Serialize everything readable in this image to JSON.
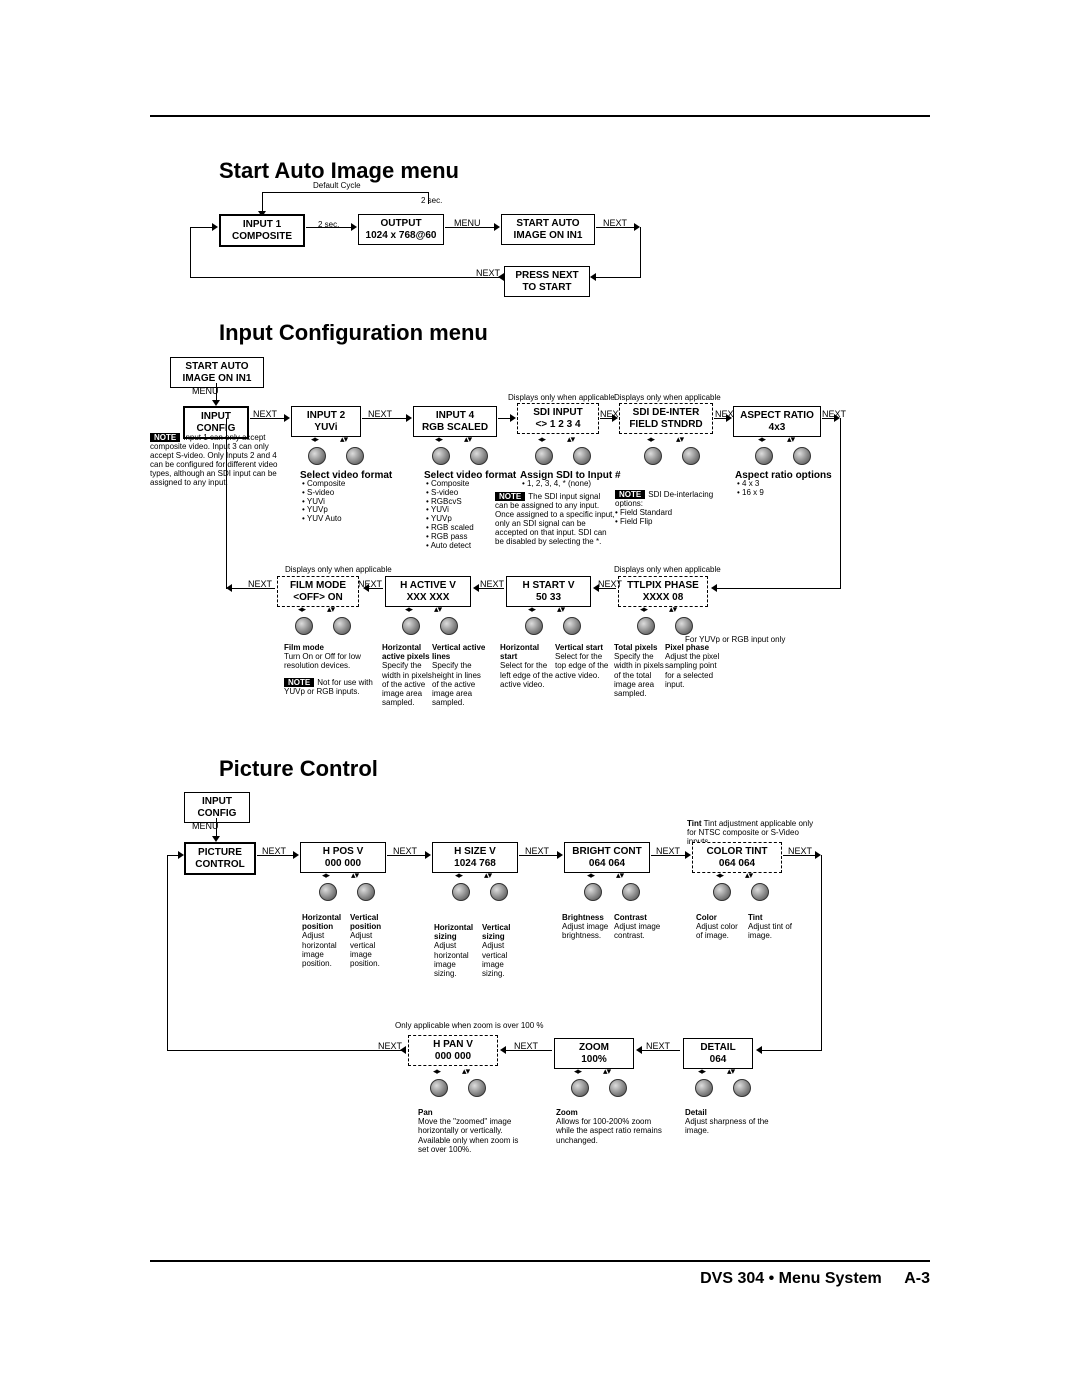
{
  "footer": {
    "product": "DVS 304 • Menu System",
    "page": "A-3"
  },
  "headings": {
    "h1": "Start Auto Image menu",
    "h2": "Input Configuration menu",
    "h3": "Picture Control"
  },
  "flow_labels": {
    "default_cycle": "Default Cycle",
    "two_sec_a": "2 sec.",
    "two_sec_b": "2 sec.",
    "menu": "MENU",
    "next": "NEXT"
  },
  "auto_image": {
    "input1": "INPUT 1\nCOMPOSITE",
    "output": "OUTPUT\n1024 x 768@60",
    "start_auto": "START AUTO\nIMAGE ON IN1",
    "press_next": "PRESS NEXT\nTO START"
  },
  "input_config": {
    "start_auto": "START AUTO\nIMAGE ON IN1",
    "input_config": "INPUT\nCONFIG",
    "input2": "INPUT 2\nYUVi",
    "input4": "INPUT 4\nRGB SCALED",
    "sdi_input": "SDI INPUT\n<>    1 2 3 4",
    "sdi_deinter": "SDI DE-INTER\nFIELD STNDRD",
    "aspect": "ASPECT RATIO\n4x3",
    "film_mode": "FILM MODE\n<OFF> ON",
    "h_active": "H   ACTIVE   V\nXXX     XXX",
    "h_start": "H   START   V\n50         33",
    "ttlpix": "TTLPIX PHASE\nXXXX      08",
    "note_input1": "Input 1 can only accept composite video. Input 3 can only accept S-video. Only Inputs 2 and 4 can be configured for different video types, although an SDI input can be assigned to any input.",
    "applicable1": "Displays only when applicable",
    "applicable2": "Displays only when applicable",
    "applicable3": "Displays only when applicable",
    "applicable4": "Displays only when applicable",
    "applicable5": "For YUVp or RGB input only",
    "sel_vid_fmt": "Select video format",
    "fmt_input2": "• Composite\n• S-video\n• YUVi\n• YUVp\n• YUV Auto",
    "fmt_input4": "• Composite\n• S-video\n• RGBcvS\n• YUVi\n• YUVp\n• RGB scaled\n• RGB pass\n• Auto detect",
    "assign_sdi_hdr": "Assign SDI to Input #",
    "assign_sdi_opts": "• 1, 2, 3, 4, * (none)",
    "note_sdi": "The SDI input signal can be assigned to any input. Once assigned to a specific input, only an SDI signal can be accepted on that input. SDI can be disabled by selecting the *.",
    "note_deinter": "SDI De-interlacing options:\n• Field Standard\n• Field Flip",
    "aspect_hdr": "Aspect ratio options",
    "aspect_opts": "• 4 x 3\n• 16 x 9",
    "film_hdr": "Film mode",
    "film_desc": "Turn On or Off for low resolution devices.",
    "note_film": "Not for use with YUVp or RGB inputs.",
    "hactive_h_hdr": "Horizontal active pixels",
    "hactive_h_desc": "Specify the width in pixels of the active image area sampled.",
    "hactive_v_hdr": "Vertical active lines",
    "hactive_v_desc": "Specify the height in lines of the active image area sampled.",
    "hstart_h_hdr": "Horizontal start",
    "hstart_h_desc": "Select for the left edge of the active video.",
    "hstart_v_hdr": "Vertical start",
    "hstart_v_desc": "Select for the top edge of the active video.",
    "ttl_h_hdr": "Total pixels",
    "ttl_h_desc": "Specify the width in pixels of the total image area sampled.",
    "ttl_v_hdr": "Pixel phase",
    "ttl_v_desc": "Adjust the pixel sampling point for a selected input."
  },
  "picture": {
    "input_config": "INPUT\nCONFIG",
    "picture_control": "PICTURE\nCONTROL",
    "hpos": "H    POS    V\n000      000",
    "hsize": "H    SIZE    V\n1024     768",
    "bright": "BRIGHT CONT\n064      064",
    "color": "COLOR   TINT\n064      064",
    "tint_note": "Tint adjustment applicable only for NTSC composite or S-Video inputs",
    "pan": "H    PAN    V\n000      000",
    "zoom": "ZOOM\n100%",
    "detail": "DETAIL\n064",
    "pan_note": "Only applicable when zoom is over 100 %",
    "hpos_h_hdr": "Horizontal position",
    "hpos_h_desc": "Adjust horizontal image position.",
    "hpos_v_hdr": "Vertical position",
    "hpos_v_desc": "Adjust vertical image position.",
    "hsize_h_hdr": "Horizontal sizing",
    "hsize_h_desc": "Adjust horizontal image sizing.",
    "hsize_v_hdr": "Vertical sizing",
    "hsize_v_desc": "Adjust vertical image sizing.",
    "bright_h_hdr": "Brightness",
    "bright_h_desc": "Adjust image brightness.",
    "bright_v_hdr": "Contrast",
    "bright_v_desc": "Adjust image contrast.",
    "color_h_hdr": "Color",
    "color_h_desc": "Adjust color of image.",
    "color_v_hdr": "Tint",
    "color_v_desc": "Adjust tint of image.",
    "pan_hdr": "Pan",
    "pan_desc": "Move the \"zoomed\" image horizontally or vertically. Available only when zoom is set over 100%.",
    "zoom_hdr": "Zoom",
    "zoom_desc": "Allows for 100-200% zoom while the aspect ratio remains unchanged.",
    "detail_hdr": "Detail",
    "detail_desc": "Adjust sharpness of the image."
  }
}
